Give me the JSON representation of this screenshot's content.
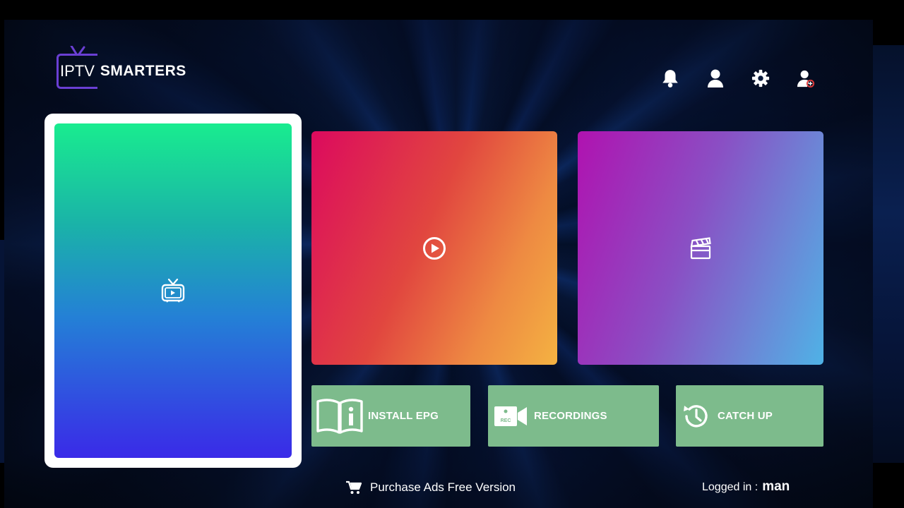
{
  "app": {
    "logo_prefix": "IPTV",
    "logo_name": "SMARTERS"
  },
  "top_icons": [
    "bell-icon",
    "user-icon",
    "gear-icon",
    "switch-user-icon"
  ],
  "tiles": {
    "live_tv": {
      "icon": "tv-icon",
      "gradient": [
        "#19ec8f",
        "#3a2ae8"
      ]
    },
    "movies": {
      "icon": "play-circle-icon",
      "gradient": [
        "#dc0a5e",
        "#f4b242"
      ]
    },
    "series": {
      "icon": "clapperboard-icon",
      "gradient": [
        "#b012b0",
        "#4fb2e6"
      ]
    }
  },
  "actions": {
    "install_epg": {
      "label": "INSTALL EPG",
      "icon": "book-info-icon"
    },
    "recordings": {
      "label": "RECORDINGS",
      "icon": "rec-camera-icon"
    },
    "catch_up": {
      "label": "CATCH UP",
      "icon": "history-clock-icon"
    }
  },
  "footer": {
    "purchase_label": "Purchase Ads Free Version",
    "logged_in_prefix": "Logged in :",
    "username": "man"
  },
  "colors": {
    "action_tile": "#7dbb8c",
    "logo_accent": "#6a3fd4",
    "selected_border": "#ffffff"
  }
}
